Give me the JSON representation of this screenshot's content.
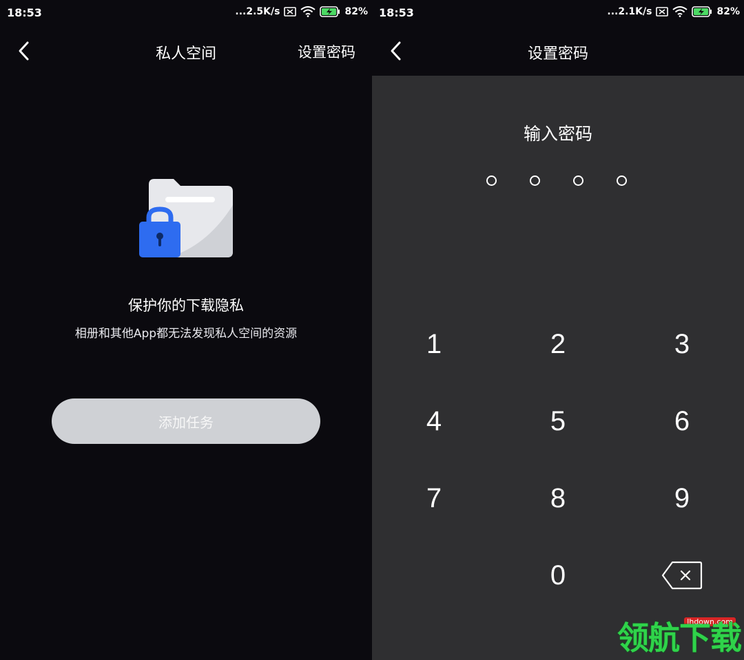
{
  "left": {
    "status": {
      "time": "18:53",
      "speed": "...2.5K/s",
      "battery": "82%"
    },
    "header": {
      "title": "私人空间",
      "action": "设置密码"
    },
    "headline": "保护你的下载隐私",
    "subline": "相册和其他App都无法发现私人空间的资源",
    "button": "添加任务"
  },
  "right": {
    "status": {
      "time": "18:53",
      "speed": "...2.1K/s",
      "battery": "82%"
    },
    "header": {
      "title": "设置密码"
    },
    "prompt": "输入密码",
    "keys": [
      "1",
      "2",
      "3",
      "4",
      "5",
      "6",
      "7",
      "8",
      "9",
      "0"
    ]
  },
  "watermark": {
    "text": "领航下载",
    "domain": "lhdown.com"
  },
  "colors": {
    "background_dark": "#0b0a0f",
    "panel_gray": "#2f2f31",
    "button_gray": "#cfd1d5",
    "lock_blue": "#2e6cf0",
    "watermark_green": "#2fd34a"
  },
  "icons": {
    "back": "chevron-left-icon",
    "wifi": "wifi-icon",
    "battery": "battery-icon",
    "sim": "sim-off-icon",
    "lock": "lock-folder-icon",
    "delete": "backspace-icon"
  }
}
